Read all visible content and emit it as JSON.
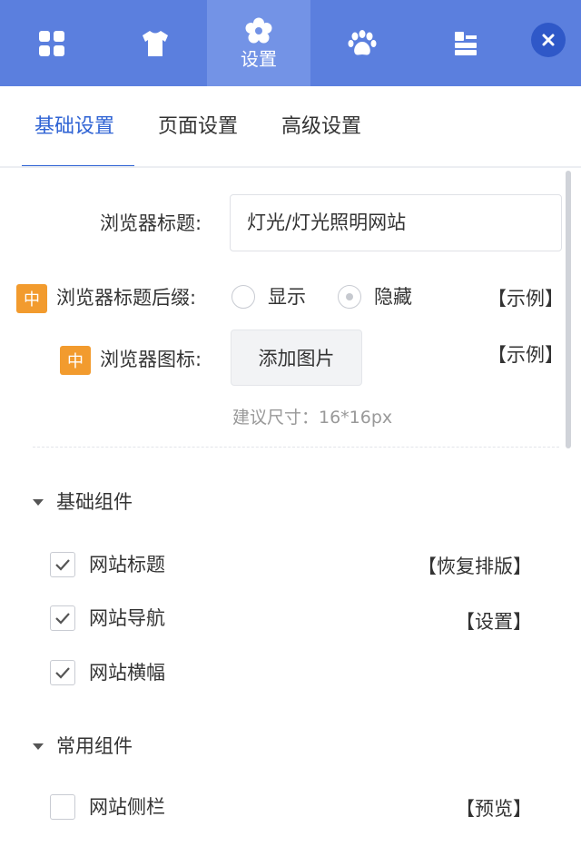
{
  "toolbar": {
    "items": [
      {
        "icon": "grid-icon",
        "label": ""
      },
      {
        "icon": "shirt-icon",
        "label": ""
      },
      {
        "icon": "gear-icon",
        "label": "设置"
      },
      {
        "icon": "paw-icon",
        "label": ""
      },
      {
        "icon": "component-icon",
        "label": ""
      }
    ],
    "active_index": 2,
    "close_icon": "close-icon",
    "bg_color": "#5b7fde",
    "active_bg_color": "#7393e6"
  },
  "tabs": [
    {
      "label": "基础设置",
      "active": true
    },
    {
      "label": "页面设置",
      "active": false
    },
    {
      "label": "高级设置",
      "active": false
    }
  ],
  "settings": {
    "browser_title": {
      "label": "浏览器标题:",
      "value": "灯光/灯光照明网站"
    },
    "title_suffix": {
      "badge": "中",
      "label": "浏览器标题后缀:",
      "options": [
        {
          "label": "显示",
          "checked": false
        },
        {
          "label": "隐藏",
          "checked": true
        }
      ],
      "example_link": "【示例】"
    },
    "favicon": {
      "badge": "中",
      "label": "浏览器图标:",
      "button": "添加图片",
      "example_link": "【示例】",
      "hint": "建议尺寸：16*16px"
    }
  },
  "sections": {
    "basic": {
      "title": "基础组件",
      "items": [
        {
          "label": "网站标题",
          "checked": true,
          "action": "【恢复排版】"
        },
        {
          "label": "网站导航",
          "checked": true,
          "action": "【设置】"
        },
        {
          "label": "网站横幅",
          "checked": true,
          "action": ""
        }
      ]
    },
    "common": {
      "title": "常用组件",
      "items": [
        {
          "label": "网站侧栏",
          "checked": false,
          "action": "【预览】"
        }
      ]
    }
  },
  "colors": {
    "accent": "#2f63d4",
    "badge": "#f29b2e"
  }
}
